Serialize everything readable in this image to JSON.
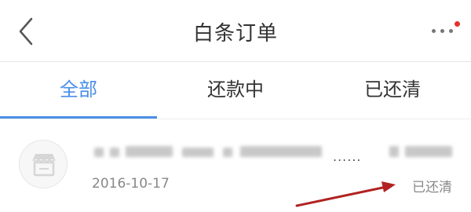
{
  "header": {
    "title": "白条订单",
    "back_icon": "chevron-left-icon",
    "more_icon": "more-horizontal-icon",
    "has_notification": true,
    "notification_color": "#e5322d"
  },
  "tabs": [
    {
      "label": "全部",
      "active": true
    },
    {
      "label": "还款中",
      "active": false
    },
    {
      "label": "已还清",
      "active": false
    }
  ],
  "accent_color": "#4a8fe7",
  "orders": [
    {
      "store_icon": "store-icon",
      "title_ellipsis": "......",
      "date": "2016-10-17",
      "status": "已还清"
    }
  ],
  "annotation": {
    "arrow_color": "#b22222"
  }
}
